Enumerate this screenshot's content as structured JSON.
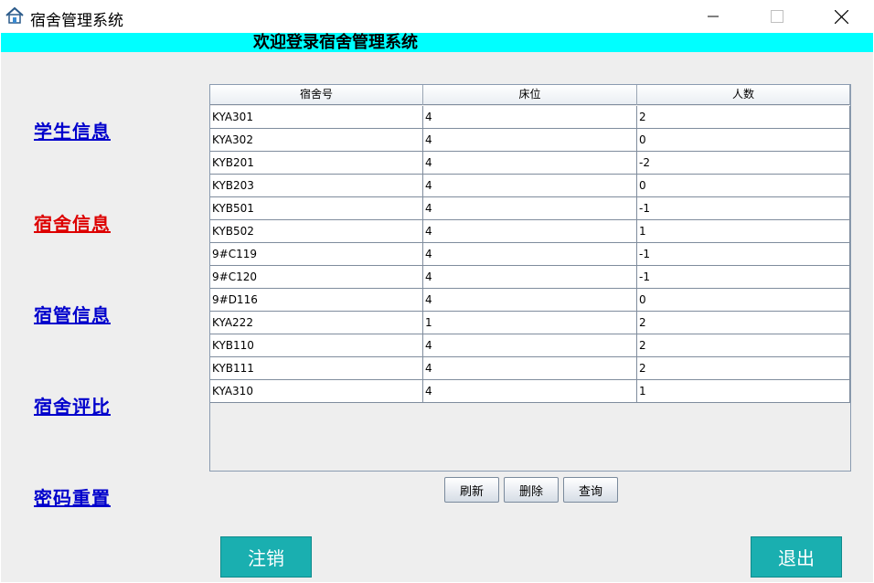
{
  "window": {
    "title": "宿舍管理系统",
    "icon": "home-icon",
    "controls": [
      "minimize-icon",
      "maximize-icon",
      "close-icon"
    ]
  },
  "welcome": {
    "text": "欢迎登录宿舍管理系统",
    "bar_color": "#00ffff"
  },
  "nav": {
    "items": [
      {
        "label": "学生信息",
        "active": false
      },
      {
        "label": "宿舍信息",
        "active": true
      },
      {
        "label": "宿管信息",
        "active": false
      },
      {
        "label": "宿舍评比",
        "active": false
      },
      {
        "label": "密码重置",
        "active": false
      }
    ],
    "link_color": "#0000cc",
    "active_color": "#dd0000"
  },
  "table": {
    "columns": [
      "宿舍号",
      "床位",
      "人数"
    ],
    "rows": [
      [
        "KYA301",
        "4",
        "2"
      ],
      [
        "KYA302",
        "4",
        "0"
      ],
      [
        "KYB201",
        "4",
        "-2"
      ],
      [
        "KYB203",
        "4",
        "0"
      ],
      [
        "KYB501",
        "4",
        "-1"
      ],
      [
        "KYB502",
        "4",
        "1"
      ],
      [
        "9#C119",
        "4",
        "-1"
      ],
      [
        "9#C120",
        "4",
        "-1"
      ],
      [
        "9#D116",
        "4",
        "0"
      ],
      [
        "KYA222",
        "1",
        "2"
      ],
      [
        "KYB110",
        "4",
        "2"
      ],
      [
        "KYB111",
        "4",
        "2"
      ],
      [
        "KYA310",
        "4",
        "1"
      ]
    ]
  },
  "actions": {
    "refresh": "刷新",
    "delete": "删除",
    "query": "查询"
  },
  "footer": {
    "logout": "注销",
    "exit": "退出",
    "button_color": "#1aafb0"
  }
}
